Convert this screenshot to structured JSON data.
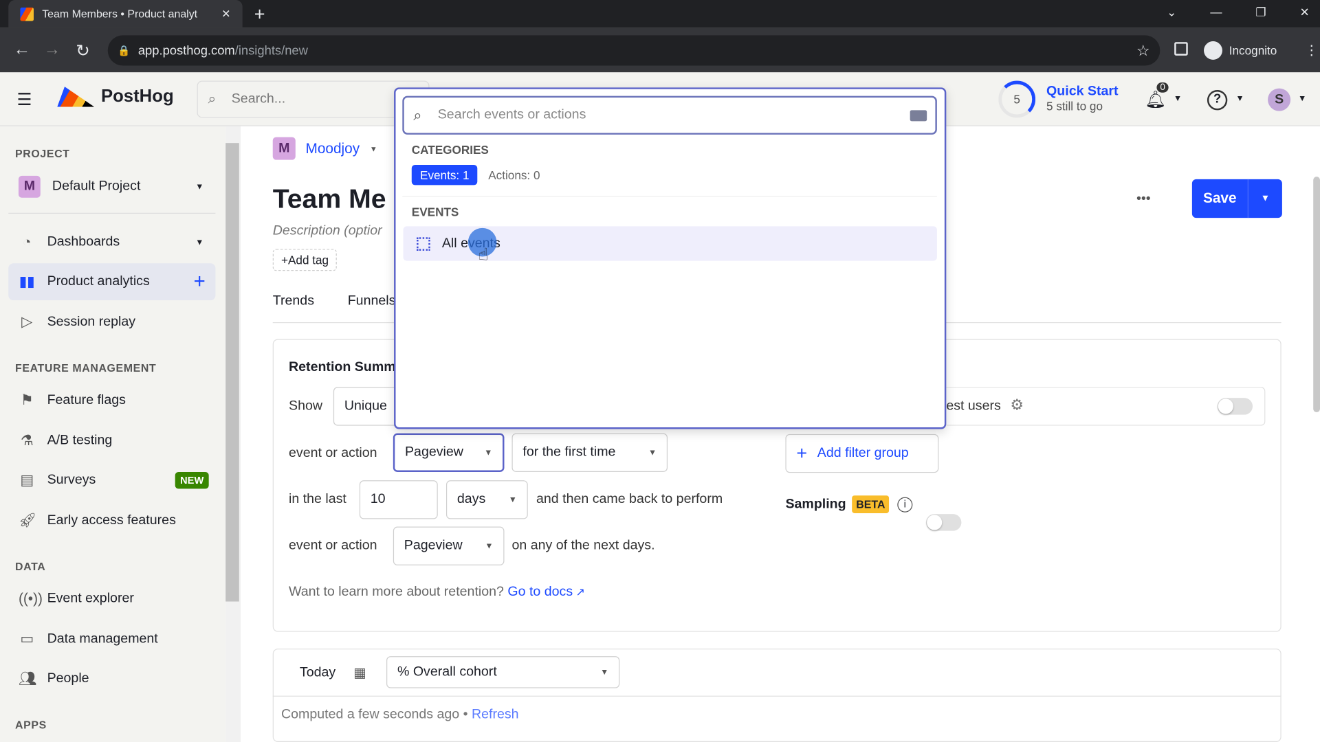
{
  "browser": {
    "tab_title": "Team Members • Product analyt",
    "url_host": "app.posthog.com",
    "url_path": "/insights/new",
    "profile": "Incognito"
  },
  "header": {
    "brand": "PostHog",
    "search_placeholder": "Search...",
    "quick_start_count": "5",
    "quick_start_title": "Quick Start",
    "quick_start_sub": "5 still to go",
    "notifications": "0",
    "avatar": "S"
  },
  "sidebar": {
    "project_heading": "PROJECT",
    "project": "Default Project",
    "project_initial": "M",
    "items": [
      {
        "label": "Dashboards"
      },
      {
        "label": "Product analytics"
      },
      {
        "label": "Session replay"
      }
    ],
    "feature_heading": "FEATURE MANAGEMENT",
    "feature_items": [
      {
        "label": "Feature flags"
      },
      {
        "label": "A/B testing"
      },
      {
        "label": "Surveys",
        "badge": "NEW"
      },
      {
        "label": "Early access features"
      }
    ],
    "data_heading": "DATA",
    "data_items": [
      {
        "label": "Event explorer"
      },
      {
        "label": "Data management"
      },
      {
        "label": "People"
      }
    ],
    "apps_heading": "APPS"
  },
  "main": {
    "project_initial": "M",
    "project": "Moodjoy",
    "title": "Team Me",
    "description": "Description (optior",
    "add_tag": "+Add tag",
    "tabs": [
      "Trends",
      "Funnels"
    ],
    "save": "Save",
    "more": "•••",
    "retention": {
      "heading": "Retention Summ",
      "show_label": "Show",
      "show_value": "Unique",
      "event_label": "event or action",
      "event_value": "Pageview",
      "first_time": "for the first time",
      "in_last": "in the last",
      "period_value": "10",
      "period_unit": "days",
      "came_back": "and then came back to perform",
      "event2_label": "event or action",
      "event2_value": "Pageview",
      "next_days": "on any of the next days.",
      "learn": "Want to learn more about retention?",
      "docs": "Go to docs"
    },
    "test_users": "est users",
    "add_filter_group": "Add filter group",
    "sampling": "Sampling",
    "beta": "BETA",
    "date": "Today",
    "cohort": "% Overall cohort",
    "computed": "Computed a few seconds ago",
    "dot": "•",
    "refresh": "Refresh"
  },
  "popover": {
    "search_placeholder": "Search events or actions",
    "categories_heading": "CATEGORIES",
    "events_tab": "Events: 1",
    "actions_tab": "Actions: 0",
    "events_heading": "EVENTS",
    "event_item": "All events"
  },
  "colors": {
    "accent": "#1d4aff",
    "beta": "#f9bd2b",
    "new_badge": "#388600"
  }
}
